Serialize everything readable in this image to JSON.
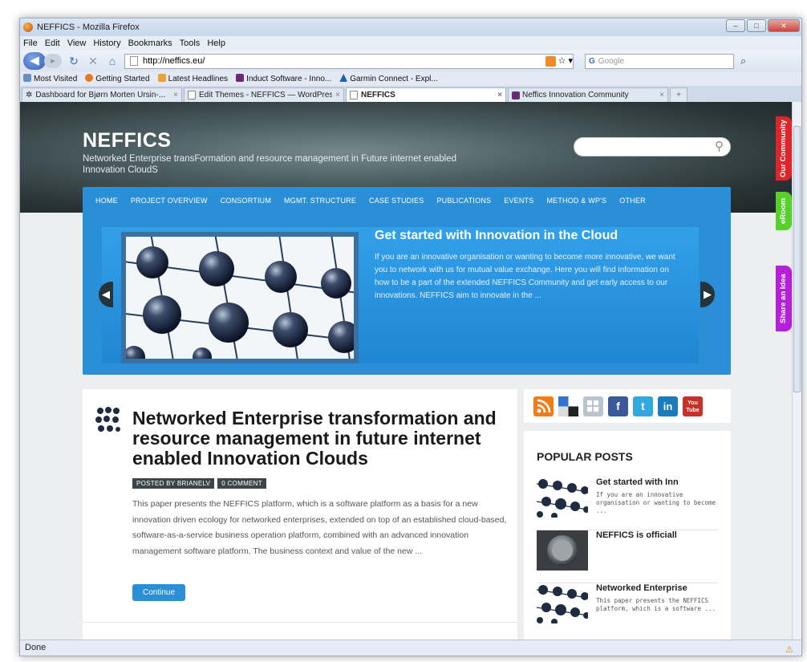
{
  "window": {
    "title": "NEFFICS - Mozilla Firefox"
  },
  "menu": [
    "File",
    "Edit",
    "View",
    "History",
    "Bookmarks",
    "Tools",
    "Help"
  ],
  "urlbar": {
    "url": "http://neffics.eu/"
  },
  "search": {
    "placeholder": "Google"
  },
  "bookmarks": [
    "Most Visited",
    "Getting Started",
    "Latest Headlines",
    "Induct Software - Inno...",
    "Garmin Connect - Expl..."
  ],
  "tabs": [
    {
      "label": "Dashboard for Bjørn Morten Ursin-..."
    },
    {
      "label": "Edit Themes - NEFFICS — WordPress"
    },
    {
      "label": "NEFFICS"
    },
    {
      "label": "Neffics Innovation Community"
    }
  ],
  "site": {
    "title": "NEFFICS",
    "tagline": "Networked Enterprise transFormation and resource management in Future internet enabled Innovation CloudS"
  },
  "nav": [
    "HOME",
    "PROJECT OVERVIEW",
    "CONSORTIUM",
    "MGMT. STRUCTURE",
    "CASE STUDIES",
    "PUBLICATIONS",
    "EVENTS",
    "METHOD & WP'S",
    "OTHER"
  ],
  "slide": {
    "title": "Get started with Innovation in the Cloud",
    "text": "If you are an innovative organisation or wanting to become more innovative, we want you to network with us for mutual value exchange. Here you will find information on how to be a part of the extended NEFFICS Community and get early access to our innovations. NEFFICS aim to innovate in the ..."
  },
  "side_tabs": [
    {
      "label": "Our Community",
      "color": "#e0252a"
    },
    {
      "label": "eRoom",
      "color": "#56d12a"
    },
    {
      "label": "Share an Idea",
      "color": "#b51fd9"
    }
  ],
  "post": {
    "title": "Networked Enterprise transformation and resource management in future internet enabled Innovation Clouds",
    "author_tag": "POSTED BY BRIANELV",
    "comment_tag": "0 COMMENT",
    "excerpt": "This paper presents the NEFFICS platform, which is a software platform as a basis for a new innovation driven ecology for networked enterprises, extended on top of an established cloud-based, software-as-a-service business operation platform, combined with an advanced innovation management software platform. The business context and value of the new ...",
    "continue_label": "Continue"
  },
  "social": [
    {
      "icon": "rss-icon",
      "color": "#f07d1a"
    },
    {
      "icon": "delicious-icon",
      "color": "#3274d0"
    },
    {
      "icon": "myspace-icon",
      "color": "#b9c4cf"
    },
    {
      "icon": "facebook-icon",
      "color": "#3b5998",
      "glyph": "f"
    },
    {
      "icon": "twitter-icon",
      "color": "#2fa9e0",
      "glyph": "t"
    },
    {
      "icon": "linkedin-icon",
      "color": "#1a7bbd",
      "glyph": "in"
    },
    {
      "icon": "youtube-icon",
      "color": "#c8302a",
      "glyph": "You Tube"
    }
  ],
  "popular": {
    "heading": "POPULAR POSTS",
    "items": [
      {
        "title": "Get started with Inn",
        "text": "If you are an innovative organisation or wanting to become ..."
      },
      {
        "title": "NEFFICS is officiall",
        "text": ""
      },
      {
        "title": "Networked Enterprise",
        "text": "This paper presents the NEFFICS platform, which is a software ..."
      }
    ]
  },
  "status": {
    "text": "Done"
  }
}
